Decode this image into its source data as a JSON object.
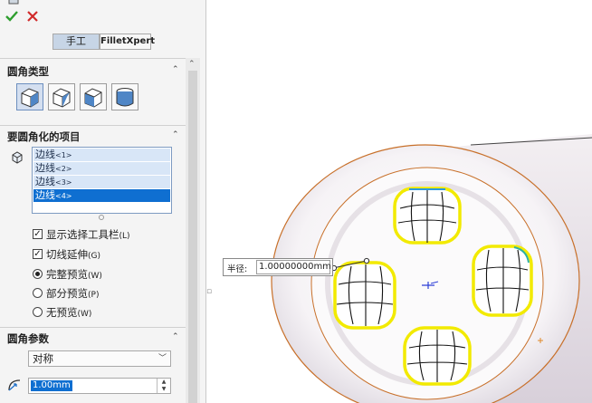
{
  "toolbar": {
    "ok_icon": "check-icon",
    "cancel_icon": "close-icon"
  },
  "mode_tabs": {
    "manual": "手工",
    "xpert": "FilletXpert"
  },
  "fillet_type": {
    "title": "圆角类型",
    "buttons": [
      "constant-size-fillet-icon",
      "variable-size-fillet-icon",
      "face-fillet-icon",
      "full-round-fillet-icon"
    ]
  },
  "items_to_fillet": {
    "title": "要圆角化的项目",
    "edges": [
      {
        "label": "边线",
        "index": "<1>"
      },
      {
        "label": "边线",
        "index": "<2>"
      },
      {
        "label": "边线",
        "index": "<3>"
      },
      {
        "label": "边线",
        "index": "<4>"
      }
    ],
    "selected_index": 3
  },
  "options": {
    "show_toolbar": {
      "label": "显示选择工具栏",
      "key": "(L)",
      "checked": true
    },
    "tangent_propagation": {
      "label": "切线延伸",
      "key": "(G)",
      "checked": true
    },
    "full_preview": {
      "label": "完整预览",
      "key": "(W)",
      "selected": true
    },
    "partial_preview": {
      "label": "部分预览",
      "key": "(P)",
      "selected": false
    },
    "no_preview": {
      "label": "无预览",
      "key": "(W)",
      "selected": false
    }
  },
  "fillet_params": {
    "title": "圆角参数",
    "method": "对称",
    "radius": "1.00mm"
  },
  "radius_callout": {
    "label": "半径:",
    "value": "1.00000000mm"
  },
  "colors": {
    "selection_yellow": "#f2ea00",
    "selection_blue": "#0f6fd1",
    "silhouette_orange": "#c8702a",
    "panel_bg": "#f4f4f4"
  }
}
